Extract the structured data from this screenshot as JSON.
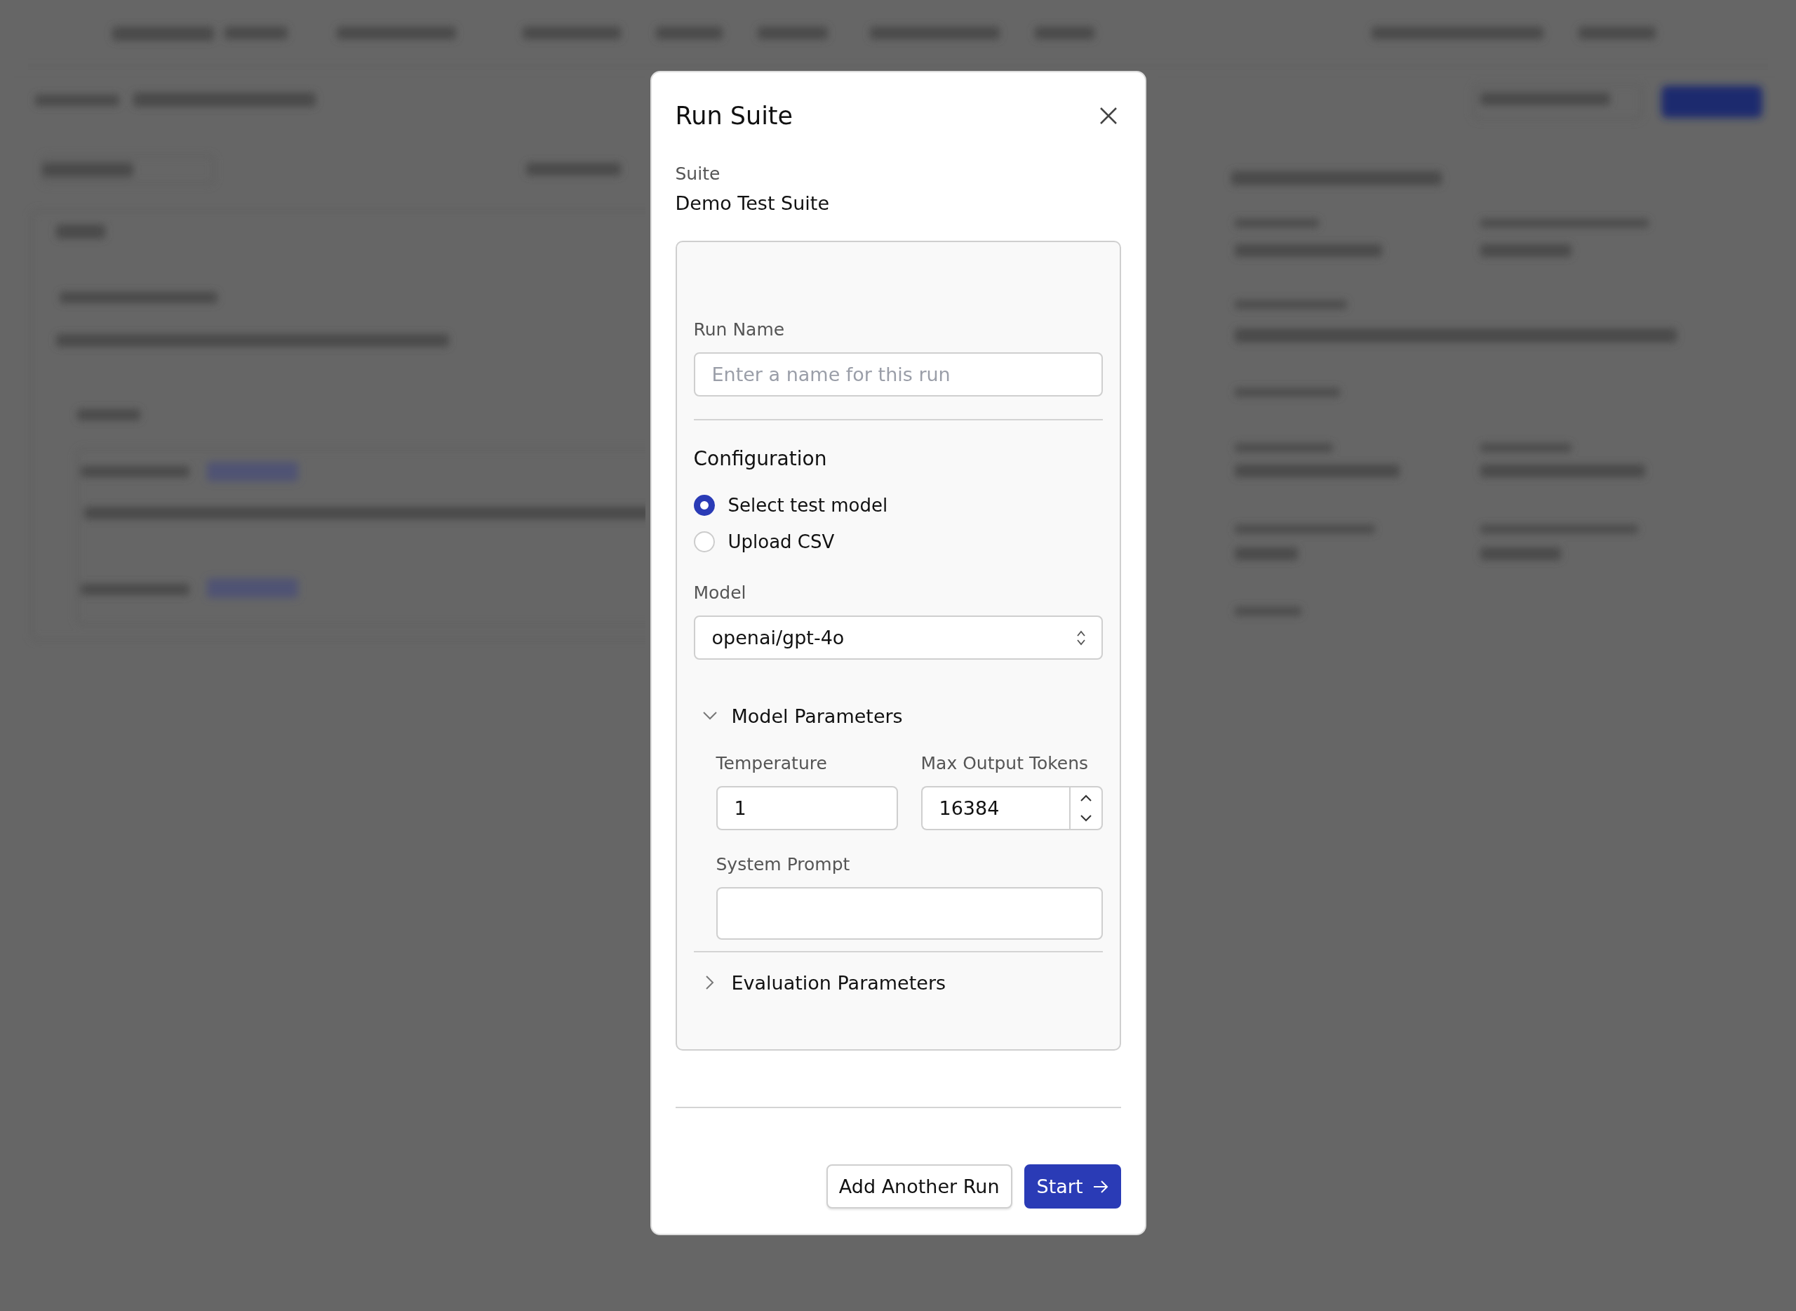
{
  "dialog": {
    "title": "Run Suite",
    "suite": {
      "label": "Suite",
      "value": "Demo Test Suite"
    },
    "run_name": {
      "label": "Run Name",
      "placeholder": "Enter a name for this run"
    },
    "configuration": {
      "heading": "Configuration",
      "options": [
        {
          "label": "Select test model",
          "selected": true
        },
        {
          "label": "Upload CSV",
          "selected": false
        }
      ]
    },
    "model": {
      "label": "Model",
      "value": "openai/gpt-4o"
    },
    "model_parameters": {
      "title": "Model Parameters",
      "expanded": true,
      "temperature": {
        "label": "Temperature",
        "value": "1"
      },
      "max_output_tokens": {
        "label": "Max Output Tokens",
        "value": "16384"
      },
      "system_prompt": {
        "label": "System Prompt"
      }
    },
    "evaluation_parameters": {
      "title": "Evaluation Parameters",
      "expanded": false
    },
    "buttons": [
      {
        "label": "Add Another Run",
        "kind": "secondary"
      },
      {
        "label": "Start",
        "kind": "primary"
      }
    ]
  }
}
